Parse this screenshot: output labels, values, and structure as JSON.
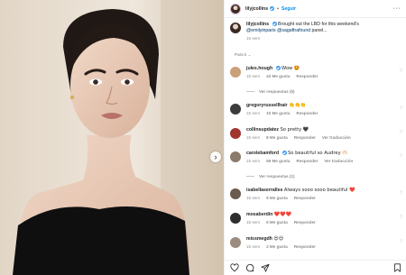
{
  "post": {
    "username": "lilyjcollins",
    "follow_label": "Seguir",
    "caption_text": "Brought out the LBD for this weekend's",
    "mentions": "@emilyinparis @sagaftrafound",
    "caption_tail": "panel...",
    "time": "15 sem",
    "for_you_label": "Para ti",
    "next_icon": "chevron-right-icon"
  },
  "comments": [
    {
      "user": "jules.hough",
      "text": "Wow 🤩",
      "time": "15 sem",
      "likes": "43 Me gusta",
      "reply": "Responder",
      "avatar_color": "#c9a07a",
      "view_replies": "Ver respuestas (5)"
    },
    {
      "user": "gregoryrussellhair",
      "text": "👏👏👏",
      "time": "15 sem",
      "likes": "10 Me gusta",
      "reply": "Responder",
      "avatar_color": "#3b3b3b"
    },
    {
      "user": "collinsupdatez",
      "text": "So pretty 🖤",
      "time": "15 sem",
      "likes": "8 Me gusta",
      "reply": "Responder",
      "translation": "Ver traducción",
      "avatar_color": "#a0342f"
    },
    {
      "user": "carolebamford",
      "text": "So beautiful so Audrey 🫶🏻",
      "time": "15 sem",
      "likes": "59 Me gusta",
      "reply": "Responder",
      "translation": "Ver traducción",
      "avatar_color": "#8a7a6a",
      "view_replies": "Ver respuestas (1)"
    },
    {
      "user": "isabellaserralles",
      "text": "Always sooo sooo beautiful ❤️",
      "time": "15 sem",
      "likes": "9 Me gusta",
      "reply": "Responder",
      "avatar_color": "#6b5a4e"
    },
    {
      "user": "mosaberdin",
      "text": "❤️❤️❤️",
      "time": "15 sem",
      "likes": "6 Me gusta",
      "reply": "Responder",
      "avatar_color": "#2e2e2e"
    },
    {
      "user": "missmegdh",
      "text": "😍😍",
      "time": "15 sem",
      "likes": "2 Me gusta",
      "reply": "Responder",
      "avatar_color": "#9c8c80"
    }
  ],
  "colors": {
    "link": "#00376b",
    "follow": "#0095f6",
    "verified": "#3897f0"
  }
}
